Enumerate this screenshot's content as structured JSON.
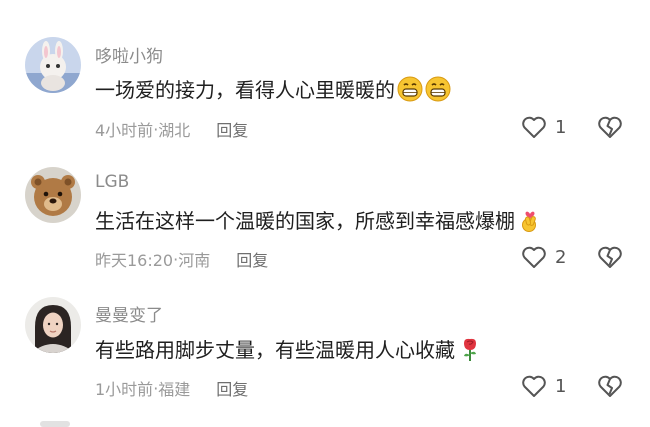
{
  "comments": [
    {
      "avatar": "avatar-cartoon-bunny",
      "username": "哆啦小狗",
      "text": "一场爱的接力，看得人心里暖暖的",
      "emojis": [
        "grin-emoji",
        "grin-emoji"
      ],
      "time": "4小时前",
      "location": "湖北",
      "reply_label": "回复",
      "like_count": "1"
    },
    {
      "avatar": "avatar-teddy-bear",
      "username": "LGB",
      "text": "生活在这样一个温暖的国家，所感到幸福感爆棚",
      "emojis": [
        "finger-heart-emoji"
      ],
      "time": "昨天16:20",
      "location": "河南",
      "reply_label": "回复",
      "like_count": "2"
    },
    {
      "avatar": "avatar-woman-photo",
      "username": "曼曼变了",
      "text": "有些路用脚步丈量，有些温暖用人心收藏",
      "emojis": [
        "rose-emoji"
      ],
      "time": "1小时前",
      "location": "福建",
      "reply_label": "回复",
      "like_count": "1"
    }
  ],
  "separator": " · ",
  "colors": {
    "text": "#1f1f1f",
    "username": "#8b8b8b",
    "meta": "#9a9a9a",
    "emoji_yellow": "#f7c531",
    "rose": "#e0343f"
  }
}
